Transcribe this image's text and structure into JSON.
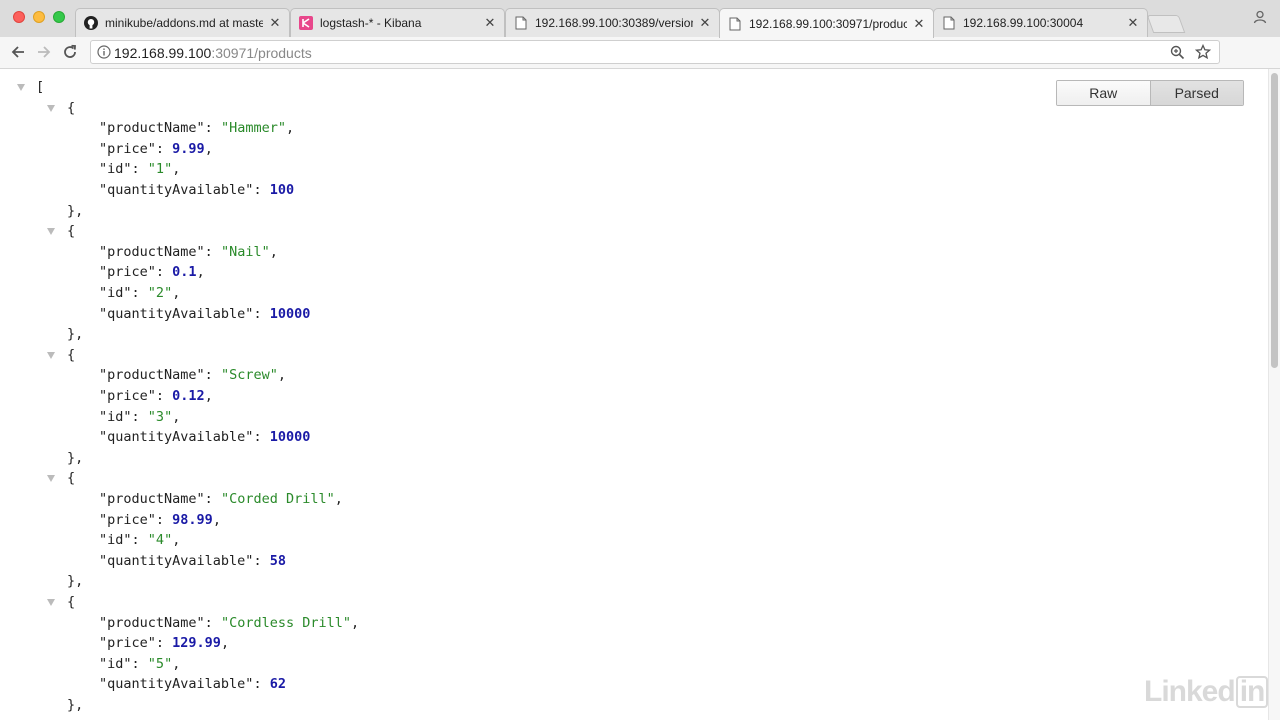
{
  "browser": {
    "tabs": [
      {
        "title": "minikube/addons.md at maste",
        "icon": "github-icon",
        "active": false
      },
      {
        "title": "logstash-* - Kibana",
        "icon": "kibana-icon",
        "active": false
      },
      {
        "title": "192.168.99.100:30389/version",
        "icon": "page-icon",
        "active": false
      },
      {
        "title": "192.168.99.100:30971/product",
        "icon": "page-icon",
        "active": true
      },
      {
        "title": "192.168.99.100:30004",
        "icon": "page-icon",
        "active": false
      }
    ],
    "address": {
      "host": "192.168.99.100",
      "path": ":30971/products"
    }
  },
  "viewer": {
    "raw_label": "Raw",
    "parsed_label": "Parsed",
    "selected": "Parsed"
  },
  "products": [
    {
      "productName": "Hammer",
      "price": "9.99",
      "id": "1",
      "quantityAvailable": "100"
    },
    {
      "productName": "Nail",
      "price": "0.1",
      "id": "2",
      "quantityAvailable": "10000"
    },
    {
      "productName": "Screw",
      "price": "0.12",
      "id": "3",
      "quantityAvailable": "10000"
    },
    {
      "productName": "Corded Drill",
      "price": "98.99",
      "id": "4",
      "quantityAvailable": "58"
    },
    {
      "productName": "Cordless Drill",
      "price": "129.99",
      "id": "5",
      "quantityAvailable": "62"
    }
  ],
  "keys": {
    "productName": "\"productName\"",
    "price": "\"price\"",
    "id": "\"id\"",
    "quantityAvailable": "\"quantityAvailable\""
  },
  "watermark": {
    "brand": "Linked",
    "suffix": "in"
  },
  "colors": {
    "string": "#2a8a2a",
    "number": "#1a1aa6",
    "active_tab": "#f6f6f6"
  }
}
